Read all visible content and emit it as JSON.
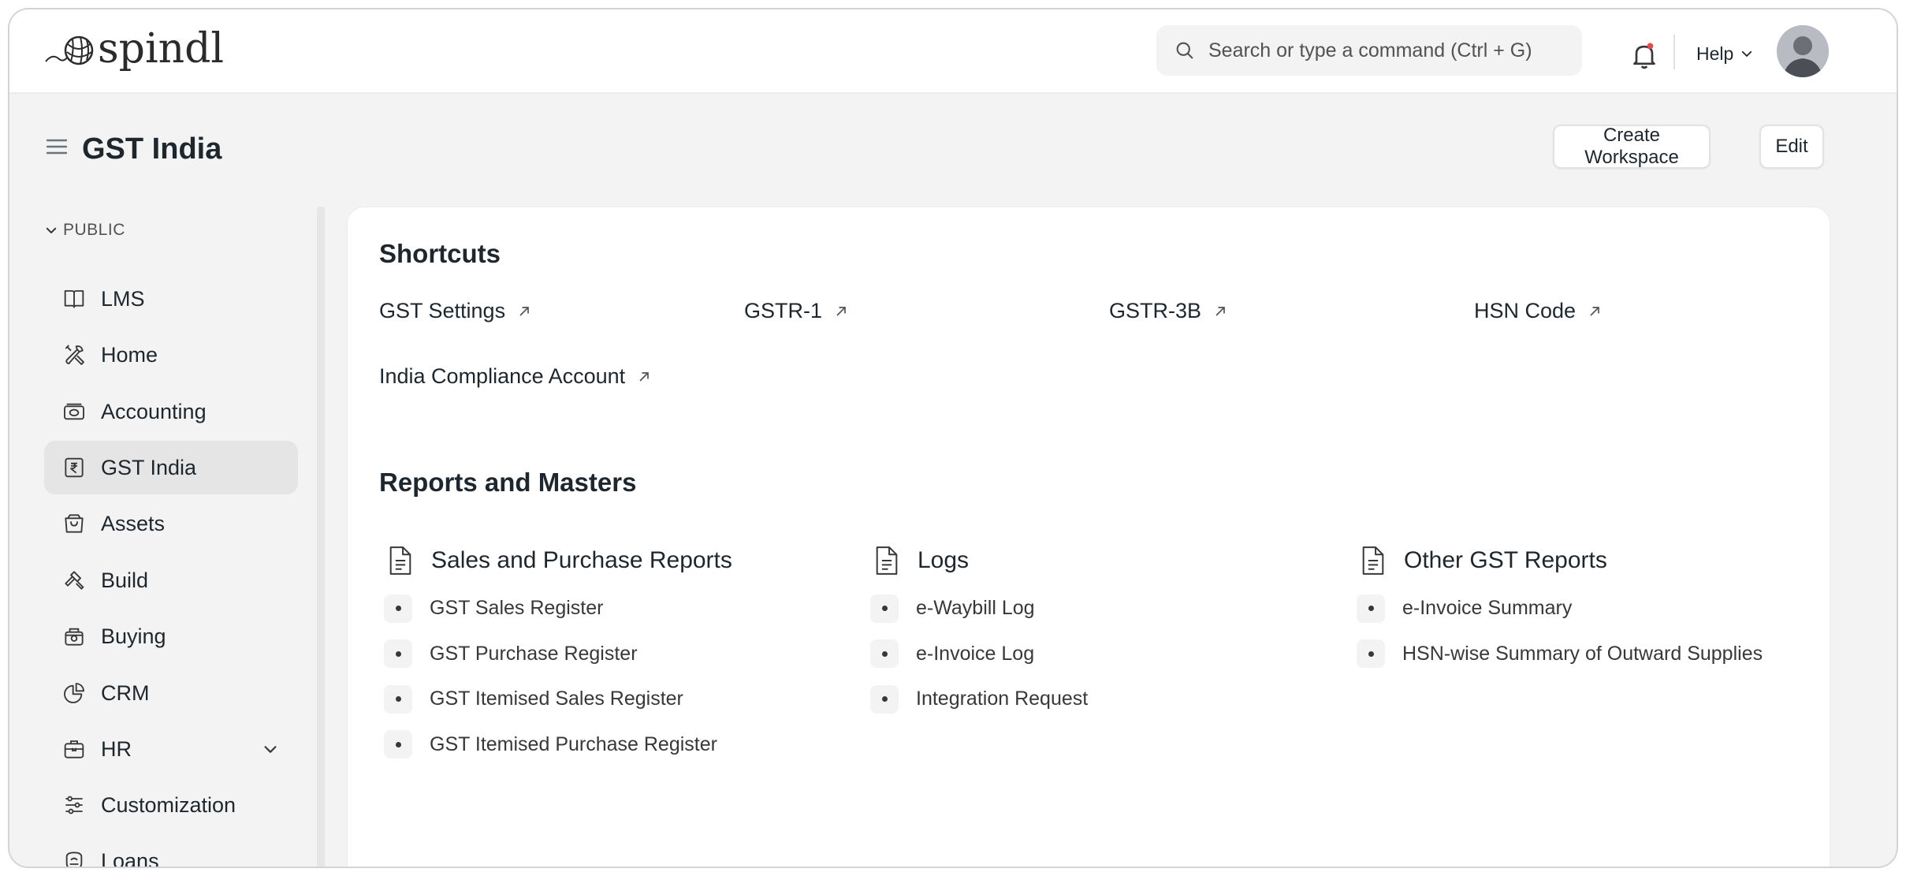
{
  "app": {
    "logo_text": "spindl"
  },
  "navbar": {
    "search_placeholder": "Search or type a command (Ctrl + G)",
    "help_label": "Help"
  },
  "page": {
    "title": "GST India",
    "create_workspace_label": "Create Workspace",
    "edit_label": "Edit"
  },
  "sidebar": {
    "section_label": "PUBLIC",
    "items": [
      {
        "label": "LMS",
        "icon": "book-icon"
      },
      {
        "label": "Home",
        "icon": "tools-icon"
      },
      {
        "label": "Accounting",
        "icon": "money-icon"
      },
      {
        "label": "GST India",
        "icon": "rupee-icon",
        "active": true
      },
      {
        "label": "Assets",
        "icon": "bag-icon"
      },
      {
        "label": "Build",
        "icon": "hammer-icon"
      },
      {
        "label": "Buying",
        "icon": "cart-icon"
      },
      {
        "label": "CRM",
        "icon": "pie-chart-icon"
      },
      {
        "label": "HR",
        "icon": "briefcase-icon",
        "expandable": true
      },
      {
        "label": "Customization",
        "icon": "sliders-icon"
      },
      {
        "label": "Loans",
        "icon": "loan-icon"
      }
    ]
  },
  "shortcuts": {
    "heading": "Shortcuts",
    "items": [
      "GST Settings",
      "GSTR-1",
      "GSTR-3B",
      "HSN Code",
      "India Compliance Account"
    ]
  },
  "reports": {
    "heading": "Reports and Masters",
    "cards": [
      {
        "title": "Sales and Purchase Reports",
        "links": [
          "GST Sales Register",
          "GST Purchase Register",
          "GST Itemised Sales Register",
          "GST Itemised Purchase Register"
        ]
      },
      {
        "title": "Logs",
        "links": [
          "e-Waybill Log",
          "e-Invoice Log",
          "Integration Request"
        ]
      },
      {
        "title": "Other GST Reports",
        "links": [
          "e-Invoice Summary",
          "HSN-wise Summary of Outward Supplies"
        ]
      }
    ]
  },
  "colors": {
    "active_bg": "#e5e5e5",
    "page_bg": "#f3f3f3",
    "notification_dot": "#e24c4c"
  }
}
